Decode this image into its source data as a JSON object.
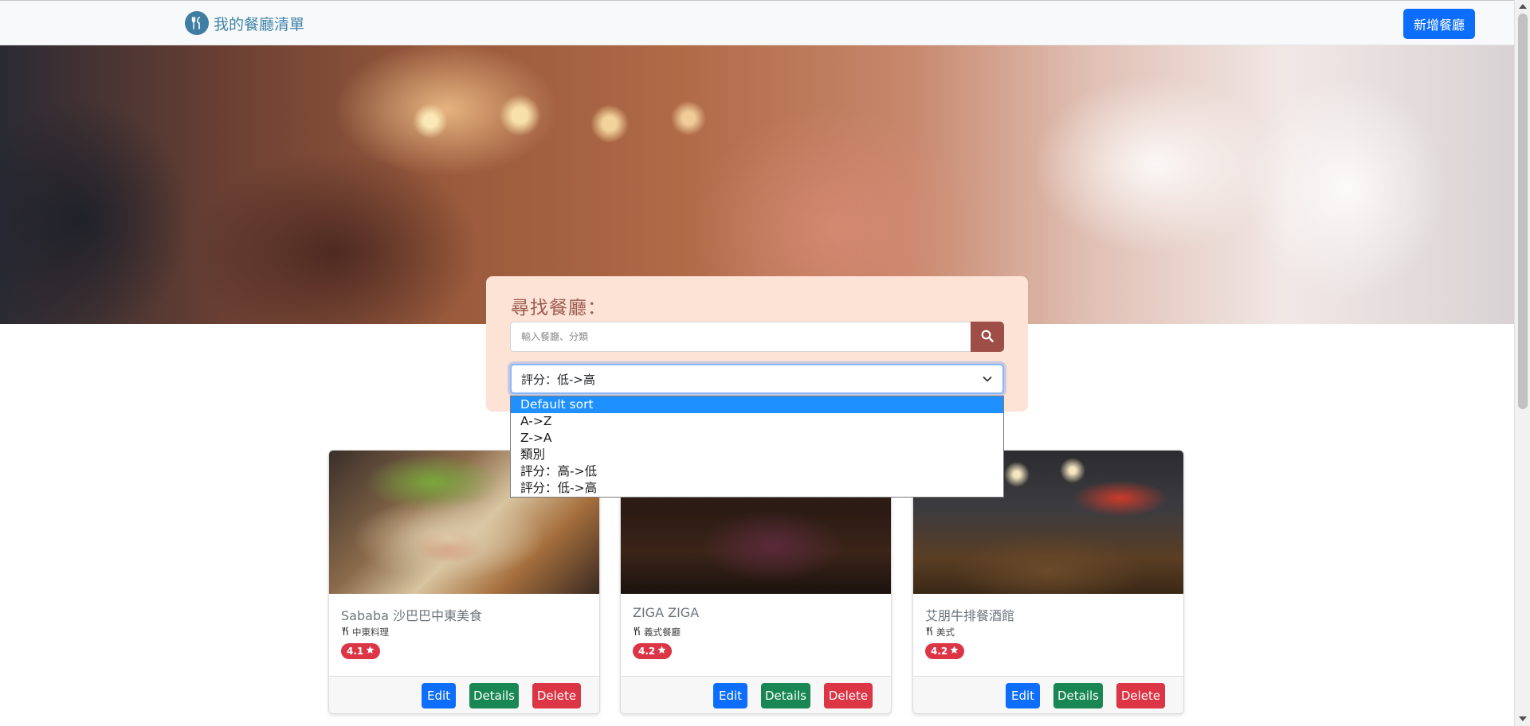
{
  "navbar": {
    "brand_text": "我的餐廳清單",
    "brand_icon": "utensils-icon",
    "new_button_label": "新增餐廳"
  },
  "search": {
    "title": "尋找餐廳：",
    "placeholder": "輸入餐廳、分類",
    "value": "",
    "button_icon": "search-icon"
  },
  "sort": {
    "selected": "評分：低->高",
    "options": [
      "Default sort",
      "A->Z",
      "Z->A",
      "類別",
      "評分：高->低",
      "評分：低->高"
    ],
    "highlighted_option": "Default sort"
  },
  "restaurants": [
    {
      "name": "Sababa 沙巴巴中東美食",
      "category": "中東料理",
      "rating": "4.1"
    },
    {
      "name": "ZIGA ZIGA",
      "category": "義式餐廳",
      "rating": "4.2"
    },
    {
      "name": "艾朋牛排餐酒館",
      "category": "美式",
      "rating": "4.2"
    }
  ],
  "card_actions": {
    "edit": "Edit",
    "details": "Details",
    "delete": "Delete"
  },
  "colors": {
    "primary": "#0d6efd",
    "success": "#198754",
    "danger": "#dc3545",
    "search_card_bg": "#fde2d6",
    "search_button": "#9e4d47",
    "brand": "#3f84a8"
  }
}
